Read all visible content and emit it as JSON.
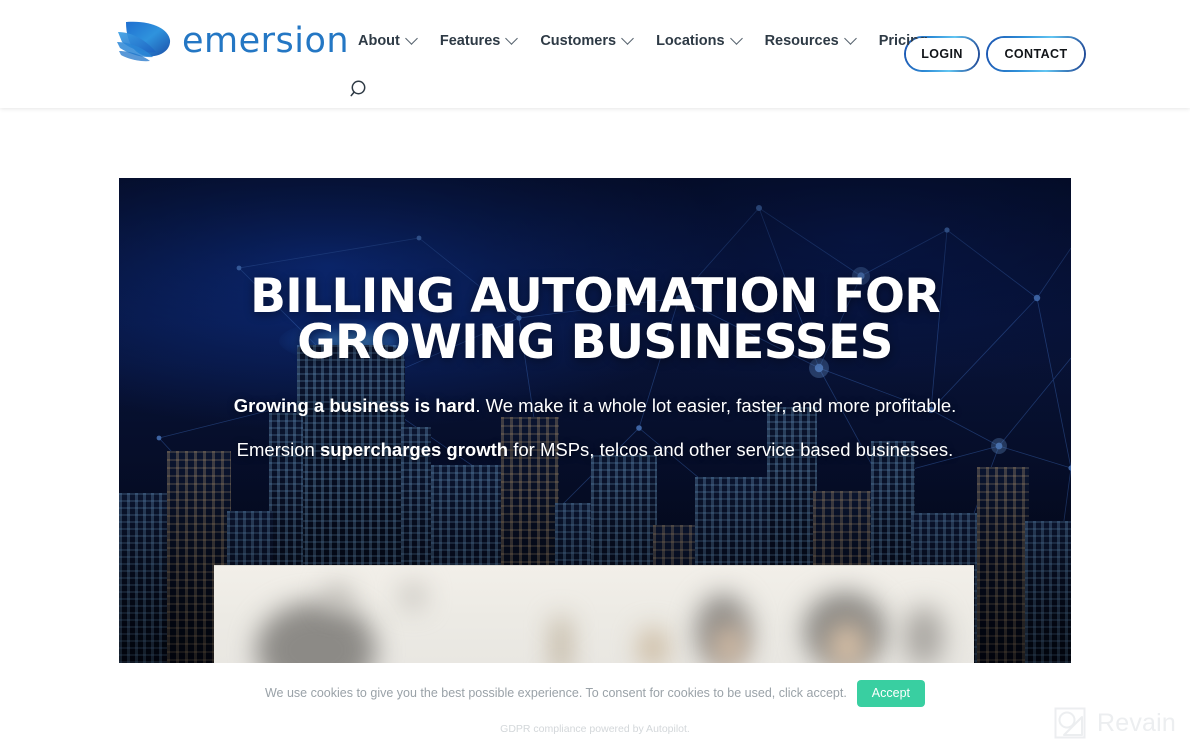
{
  "header": {
    "logo": {
      "icon": "emersion-leaf-logo-icon",
      "wordmark": "emersion"
    },
    "nav": [
      {
        "label": "About",
        "has_dropdown": true
      },
      {
        "label": "Features",
        "has_dropdown": true
      },
      {
        "label": "Customers",
        "has_dropdown": true
      },
      {
        "label": "Locations",
        "has_dropdown": true
      },
      {
        "label": "Resources",
        "has_dropdown": true
      },
      {
        "label": "Pricing",
        "has_dropdown": false
      }
    ],
    "search_icon": "search-icon",
    "login_label": "LOGIN",
    "contact_label": "CONTACT",
    "accent_border": "#2f8fd8"
  },
  "hero": {
    "title_line1": "BILLING AUTOMATION FOR",
    "title_line2": "GROWING BUSINESSES",
    "sub1_bold": "Growing a business is hard",
    "sub1_rest": ". We make it a whole lot easier, faster, and more profitable.",
    "sub2_pre": "Emersion ",
    "sub2_bold": "supercharges growth",
    "sub2_rest": " for MSPs, telcos and other service based businesses.",
    "background": "night-city-skyline-with-network-overlay",
    "bg_color": "#050d2c"
  },
  "cookie": {
    "message": "We use cookies to give you the best possible experience. To consent for cookies to be used, click accept.",
    "accept_label": "Accept",
    "accept_color": "#39cfa1",
    "gdpr_note": "GDPR compliance powered by Autopilot."
  },
  "watermark": {
    "label": "Revain",
    "icon": "revain-logo-icon"
  }
}
